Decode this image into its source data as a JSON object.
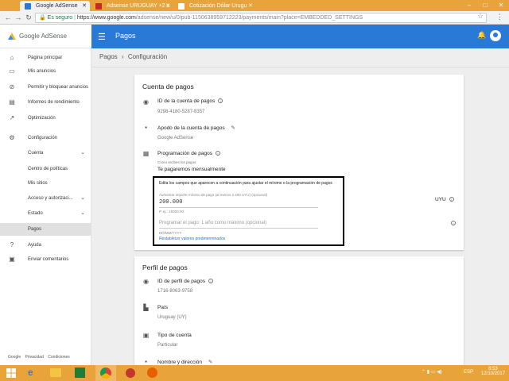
{
  "browser": {
    "tabs": [
      {
        "label": "Google AdSense",
        "color": "#2979d6"
      },
      {
        "label": "Adsense URUGUAY +2 a",
        "color": "#e8a33b"
      },
      {
        "label": "Cotización Dólar Urugu",
        "color": "#e8a33b"
      }
    ],
    "security_label": "Es seguro",
    "url_host": "https://www.google.com",
    "url_path": "/adsense/new/u/0/pub-1150638959712223/payments/main?place=EMBEDDED_SETTINGS"
  },
  "header": {
    "logo_text": "Google AdSense",
    "title": "Pagos"
  },
  "sidebar": {
    "items": [
      {
        "label": "Página principal",
        "icon": "home-icon"
      },
      {
        "label": "Mis anuncios",
        "icon": "ads-icon"
      },
      {
        "label": "Permitir y bloquear anuncios",
        "icon": "block-icon"
      },
      {
        "label": "Informes de rendimiento",
        "icon": "reports-icon"
      },
      {
        "label": "Optimización",
        "icon": "optimization-icon"
      },
      {
        "label": "Configuración",
        "icon": "gear-icon"
      },
      {
        "label": "Cuenta"
      },
      {
        "label": "Centro de políticas"
      },
      {
        "label": "Mis sitios"
      },
      {
        "label": "Acceso y autorizaci..."
      },
      {
        "label": "Estado"
      },
      {
        "label": "Pagos"
      },
      {
        "label": "Ayuda",
        "icon": "help-icon"
      },
      {
        "label": "Enviar comentarios",
        "icon": "feedback-icon"
      }
    ],
    "footer": [
      "Google",
      "Privacidad",
      "Condiciones"
    ]
  },
  "breadcrumb": {
    "parent": "Pagos",
    "separator": "›",
    "current": "Configuración"
  },
  "payment_account": {
    "title": "Cuenta de pagos",
    "id_label": "ID de la cuenta de pagos",
    "id_value": "9298-4180-5287-8357",
    "nickname_label": "Apodo de la cuenta de pagos",
    "nickname_value": "Google AdSense",
    "schedule_label": "Programación de pagos",
    "schedule_hint": "Cómo recibes los pagos",
    "schedule_value": "Te pagaremos mensualmente",
    "edit_notice": "Edita los campos que aparecen a continuación para ajustar el mínimo o la programación de pagos",
    "threshold_label": "Aumentar importe mínimo de pago (al menos 2.400 UYU) (opcional)",
    "threshold_value": "200.000",
    "threshold_example": "P. ej.: 15000.00",
    "currency": "UYU",
    "hold_label": "Programar el pago: 1 año como máximo (opcional)",
    "date_placeholder": "DD/MM/YYYY",
    "reset_link": "Restablecer valores predeterminados"
  },
  "payment_profile": {
    "title": "Perfil de pagos",
    "id_label": "ID de perfil de pagos",
    "id_value": "1716-8063-9758",
    "country_label": "País",
    "country_value": "Uruguay (UY)",
    "type_label": "Tipo de cuenta",
    "type_value": "Particular",
    "address_label": "Nombre y dirección"
  },
  "taskbar": {
    "lang": "ESP",
    "time": "8:53",
    "date": "12/10/2017"
  },
  "colors": {
    "brand_blue": "#2979d6",
    "link_blue": "#1a73e8",
    "taskbar": "#e8a33b"
  }
}
